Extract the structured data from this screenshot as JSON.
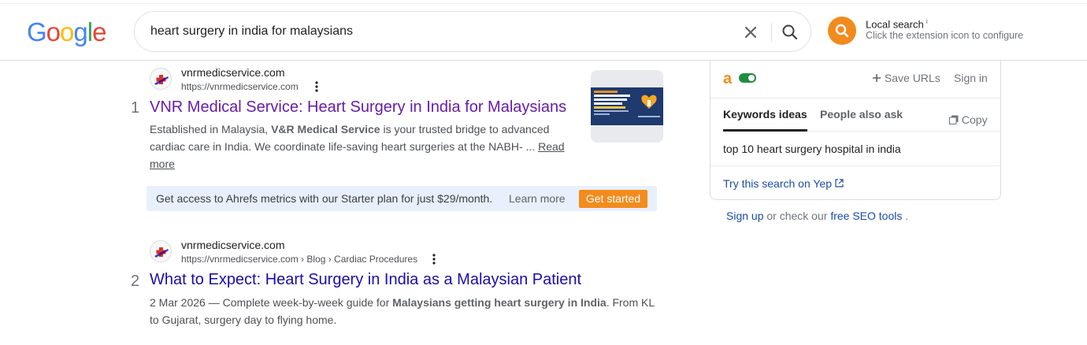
{
  "header": {
    "logo_letters": [
      "G",
      "o",
      "o",
      "g",
      "l",
      "e"
    ],
    "logo_colors": [
      "#4285f4",
      "#ea4335",
      "#fbbc05",
      "#4285f4",
      "#34a853",
      "#ea4335"
    ],
    "search_value": "heart surgery in india for malaysians",
    "extension": {
      "title": "Local search",
      "info": "i",
      "subtitle": "Click the extension icon to configure",
      "icon": "search-icon",
      "color": "#f28b1e"
    }
  },
  "results": [
    {
      "rank": "1",
      "site_name": "vnrmedicservice.com",
      "url": "https://vnrmedicservice.com",
      "title": "VNR Medical Service: Heart Surgery in India for Malaysians",
      "snippet_line1_a": "Established in Malaysia, ",
      "snippet_line1_b": "V&R Medical Service",
      "snippet_line1_c": " is your trusted bridge to advanced",
      "snippet_line2": "cardiac care in India. We coordinate life-saving heart surgeries at the NABH- ... ",
      "read": "Read",
      "more": "more",
      "thumbnail_text": "Pediatric Heart Surgery Cost in India for Malaysian Families"
    },
    {
      "rank": "2",
      "site_name": "vnrmedicservice.com",
      "url": "https://vnrmedicservice.com › Blog › Cardiac Procedures",
      "title": "What to Expect: Heart Surgery in India as a Malaysian Patient",
      "snippet_line1_a": "2 Mar 2026 — Complete week-by-week guide for ",
      "snippet_line1_b": "Malaysians getting heart surgery in India",
      "snippet_line1_c": ". From KL",
      "snippet_line2": "to Gujarat, surgery day to flying home."
    }
  ],
  "ahrefs_bar": {
    "message": "Get access to Ahrefs metrics with our Starter plan for just $29/month.",
    "learn_more": "Learn more",
    "get_started": "Get started"
  },
  "panel": {
    "logo": "a",
    "save_urls": "Save URLs",
    "sign_in": "Sign in",
    "tabs": [
      "Keywords ideas",
      "People also ask"
    ],
    "copy": "Copy",
    "keyword": "top 10 heart surgery hospital in india",
    "try_yep": "Try this search on Yep",
    "accent": "#f38c1d"
  },
  "signup": {
    "sign_up": "Sign up",
    "middle": " or check our ",
    "free_tools": "free SEO tools",
    "end": " ."
  }
}
